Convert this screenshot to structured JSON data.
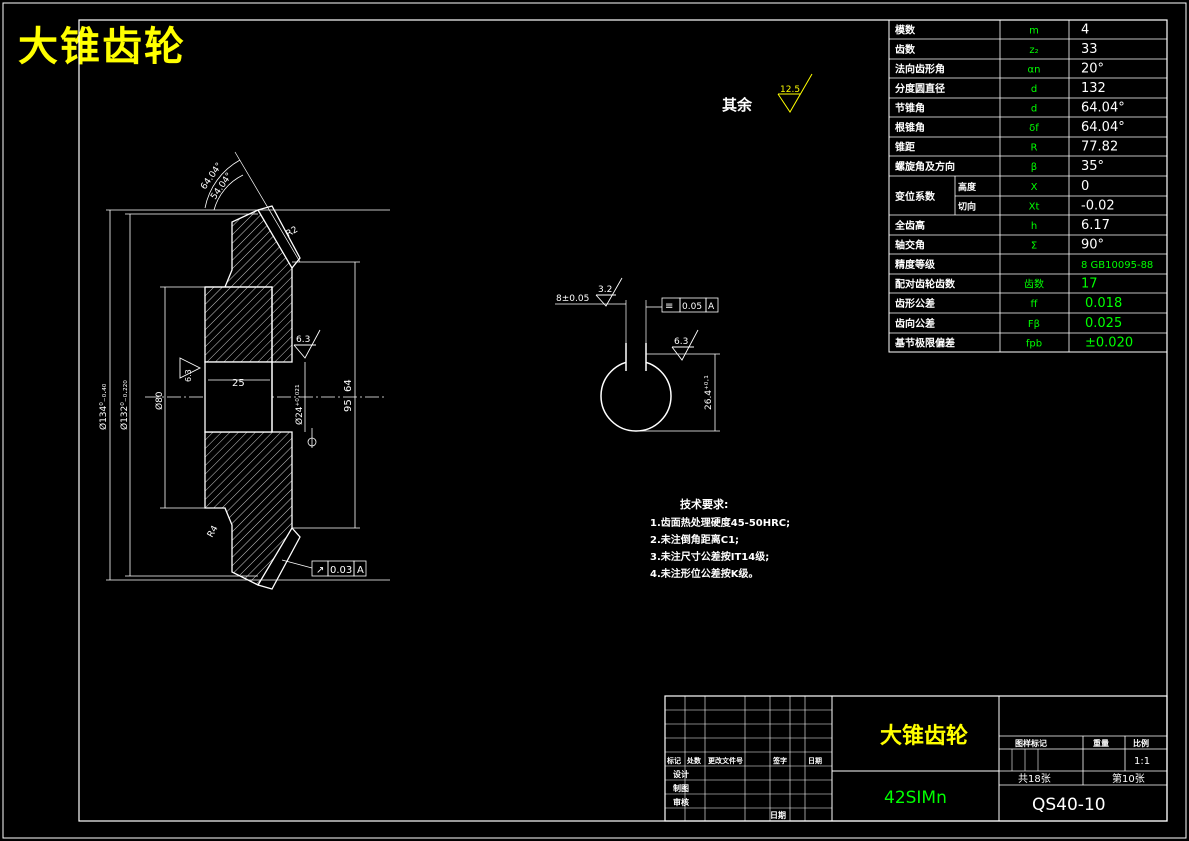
{
  "title": "大锥齿轮",
  "surface": {
    "label": "其余",
    "roughness": "12.5"
  },
  "params": [
    {
      "name": "模数",
      "sym": "m",
      "val": "4"
    },
    {
      "name": "齿数",
      "sym": "z₂",
      "val": "33"
    },
    {
      "name": "法向齿形角",
      "sym": "αn",
      "val": "20°"
    },
    {
      "name": "分度圆直径",
      "sym": "d",
      "val": "132"
    },
    {
      "name": "节锥角",
      "sym": "d",
      "val": "64.04°"
    },
    {
      "name": "根锥角",
      "sym": "δf",
      "val": "64.04°"
    },
    {
      "name": "锥距",
      "sym": "R",
      "val": "77.82"
    },
    {
      "name": "螺旋角及方向",
      "sym": "β",
      "val": "35°"
    },
    {
      "name": "变位系数",
      "sub": "高度",
      "sym": "X",
      "val": "0"
    },
    {
      "name": "",
      "sub": "切向",
      "sym": "Xt",
      "val": "-0.02"
    },
    {
      "name": "全齿高",
      "sym": "h",
      "val": "6.17"
    },
    {
      "name": "轴交角",
      "sym": "Σ",
      "val": "90°"
    },
    {
      "name": "精度等级",
      "sym": "",
      "val": "8 GB10095-88"
    },
    {
      "name": "配对齿轮齿数",
      "sym": "齿数",
      "val": "17"
    },
    {
      "name": "齿形公差",
      "sym": "ff",
      "val": "0.018"
    },
    {
      "name": "齿向公差",
      "sym": "Fβ",
      "val": "0.025"
    },
    {
      "name": "基节极限偏差",
      "sym": "fpb",
      "val": "±0.020"
    }
  ],
  "requirements": {
    "heading": "技术要求:",
    "items": [
      "1.齿面热处理硬度45-50HRC;",
      "2.未注倒角距离C1;",
      "3.未注尺寸公差按IT14级;",
      "4.未注形位公差按K级。"
    ]
  },
  "titleblock": {
    "part_name": "大锥齿轮",
    "material": "42SIMn",
    "drawing_no": "QS40-10",
    "headers": [
      "标记",
      "处数",
      "更改文件号",
      "签字",
      "日期"
    ],
    "roles": [
      "设计",
      "制图",
      "审核"
    ],
    "date_label": "日期",
    "stage_label": "图样标记",
    "weight_label": "重量",
    "scale_label": "比例",
    "scale": "1:1",
    "sheets_total": "共18张",
    "sheet_no": "第10张"
  },
  "dims": {
    "angle1": "64.04°",
    "angle2": "54.04°",
    "fillet_top": "R2",
    "fillet_bottom": "R4",
    "d_outer": "Ø134⁰₋₀.₄₀",
    "d_pitch": "Ø132⁰₋₀.₂₂₀",
    "d_hub": "Ø80",
    "bore_len": "25",
    "bore_d": "Ø24⁺⁰·⁰²¹",
    "len_95": "95",
    "len_64": "64",
    "rough_63": "6.3",
    "runout": "0.03",
    "datum": "A",
    "key_width": "8±0.05",
    "rough_32": "3.2",
    "sym_tol": "0.05",
    "key_depth": "26.4⁺⁰·¹",
    "rough_63b": "6.3"
  },
  "colors": {
    "frame": "#ffffff",
    "text": "#ffffff",
    "value": "#00ff00",
    "title": "#ffff00",
    "geometry": "#ffffff"
  }
}
